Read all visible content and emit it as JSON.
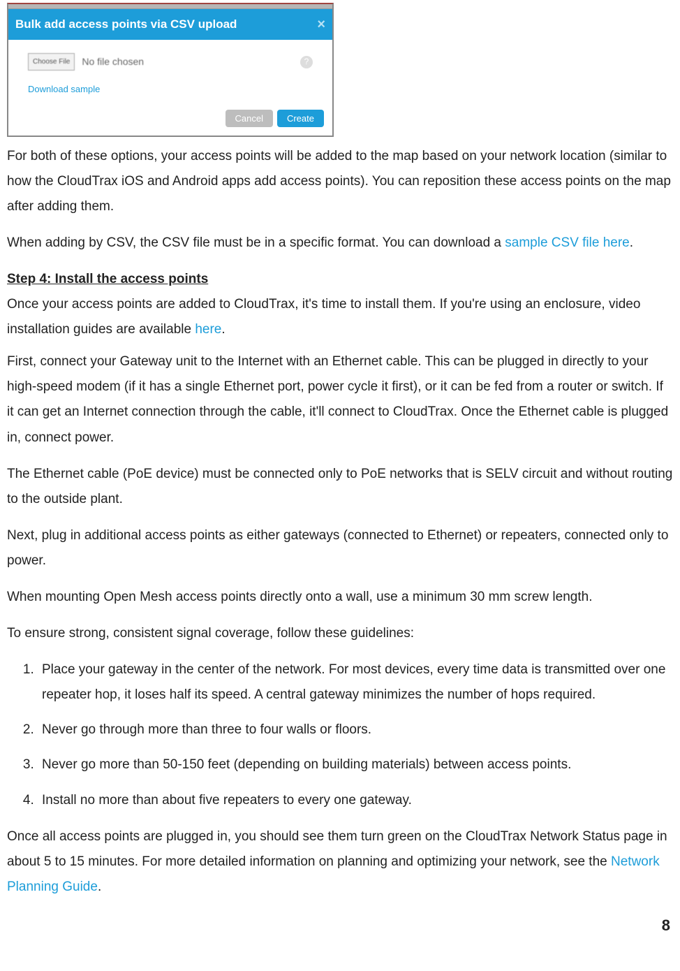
{
  "dialog": {
    "title": "Bulk add access points via CSV upload",
    "close": "×",
    "choose_file": "Choose File",
    "no_file": "No file chosen",
    "help": "?",
    "download_sample": "Download sample",
    "cancel": "Cancel",
    "create": "Create"
  },
  "para1_a": "For both of these options, your access points will be added to the map based on your network location (similar to how the CloudTrax iOS and Android apps add access points). You can reposition these access points on the map after adding them.",
  "para2_a": "When adding by CSV, the CSV file must be in a specific format. You can download a ",
  "para2_link": "sample CSV file here",
  "para2_b": ".",
  "step4_title": "Step 4: Install the access points",
  "step4_p1_a": "Once your access points are added to CloudTrax, it's time to install them. If you're using an enclosure, video installation guides are available ",
  "step4_p1_link": "here",
  "step4_p1_b": ".",
  "step4_p2": "First, connect your Gateway unit to the Internet with an Ethernet cable. This can be plugged in directly to your high-speed modem (if it has a single Ethernet port, power cycle it first), or it can be fed from a router or switch. If it can get an Internet connection through the cable, it'll connect to CloudTrax. Once the Ethernet cable is plugged in, connect power.",
  "step4_p3": "The Ethernet cable (PoE device) must be connected only to PoE networks that is SELV circuit and without routing to the outside plant.",
  "step4_p4": "Next, plug in additional access points as either gateways (connected to Ethernet) or repeaters, connected only to power.",
  "step4_p5": "When mounting Open Mesh access points directly onto a wall, use a minimum 30 mm screw length.",
  "step4_p6": "To ensure strong, consistent signal coverage, follow these guidelines:",
  "guidelines": [
    "Place your gateway in the center of the network. For most devices, every time data is transmitted over one repeater hop, it loses half its speed. A central gateway minimizes the number of hops required.",
    "Never go through more than three to four walls or floors.",
    "Never go more than 50-150 feet (depending on building materials) between access points.",
    "Install no more than about five repeaters to every one gateway."
  ],
  "step4_p7_a": "Once all access points are plugged in, you should see them turn green on the CloudTrax Network Status page in about 5 to 15 minutes. For more detailed information on planning and optimizing your network, see the ",
  "step4_p7_link": "Network Planning Guide",
  "step4_p7_b": ".",
  "page_number": "8"
}
